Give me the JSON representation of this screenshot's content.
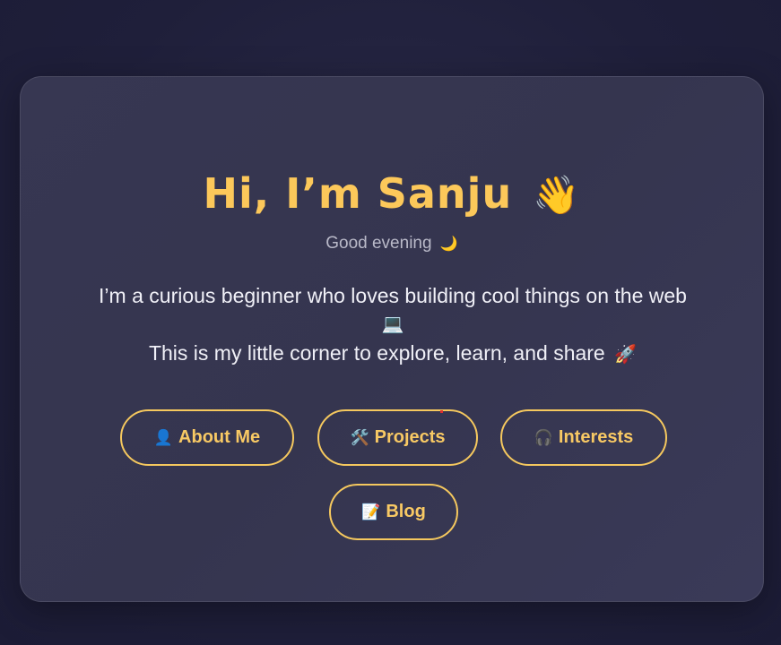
{
  "hero": {
    "title": "Hi, I’m Sanju",
    "title_emoji": "👋",
    "greeting": "Good evening",
    "greeting_emoji": "🌙",
    "intro_line1": "I’m a curious beginner who loves building cool things on the web",
    "intro_emoji1": "💻",
    "intro_line2": "This is my little corner to explore, learn, and share",
    "intro_emoji2": "🚀"
  },
  "nav": {
    "about": {
      "icon": "👤",
      "label": "About Me"
    },
    "projects": {
      "icon": "🛠️",
      "label": "Projects"
    },
    "interests": {
      "icon": "🎧",
      "label": "Interests"
    },
    "blog": {
      "icon": "📝",
      "label": "Blog"
    }
  },
  "colors": {
    "accent": "#f8c964",
    "background": "#1f1f3a",
    "card": "#373752"
  }
}
